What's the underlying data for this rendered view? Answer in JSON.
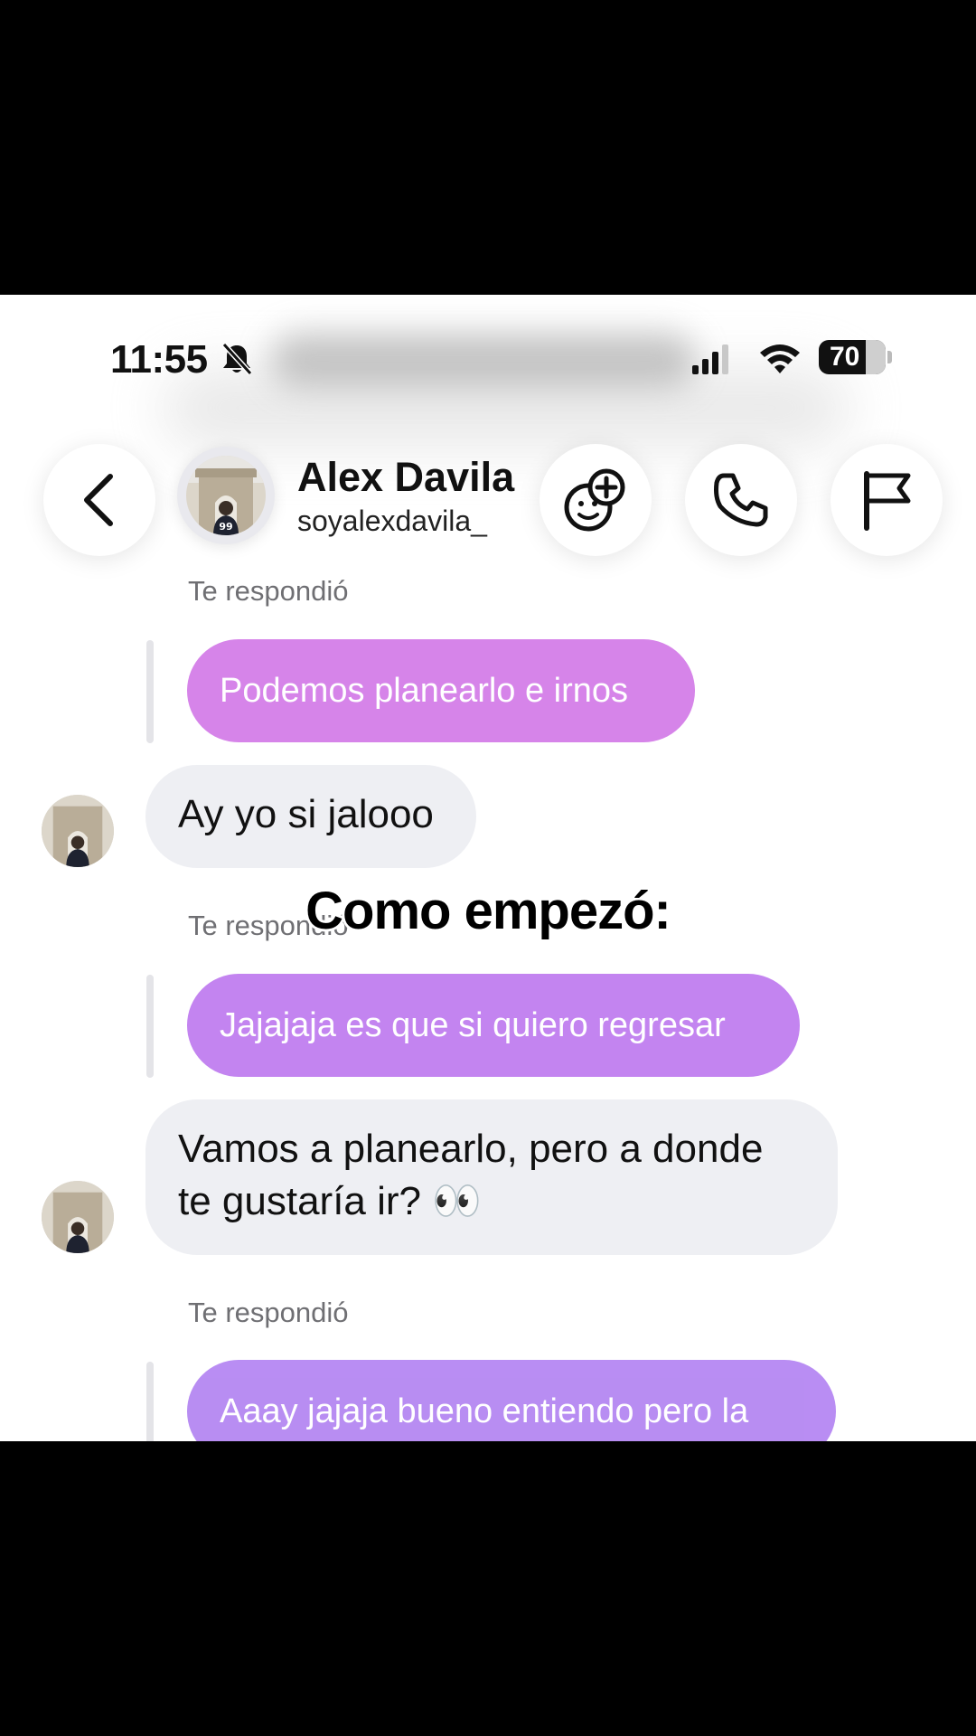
{
  "status_bar": {
    "time": "11:55",
    "battery": "70"
  },
  "header": {
    "name": "Alex Davila",
    "handle": "soyalexdavila_"
  },
  "caption": "Como empezó:",
  "messages": [
    {
      "type": "reply-label",
      "text": "Te respondió"
    },
    {
      "type": "sent",
      "text": "Podemos planearlo e irnos",
      "color": "#d47ee8"
    },
    {
      "type": "received",
      "text": "Ay yo si jalooo"
    },
    {
      "type": "reply-label",
      "text": "Te respondió"
    },
    {
      "type": "sent",
      "text": "Jajajaja es que si quiero regresar",
      "color": "#c07ef0"
    },
    {
      "type": "received",
      "line1": "Vamos a planearlo, pero a donde",
      "line2": "te gustaría ir? 👀"
    },
    {
      "type": "reply-label",
      "text": "Te respondió"
    },
    {
      "type": "sent",
      "text": "Aaay jajaja bueno entiendo pero la",
      "color": "#b587f2"
    }
  ],
  "icons": [
    "bell-slash-icon",
    "signal-icon",
    "wifi-icon",
    "back-arrow-icon",
    "effects-icon",
    "phone-icon",
    "flag-icon"
  ]
}
